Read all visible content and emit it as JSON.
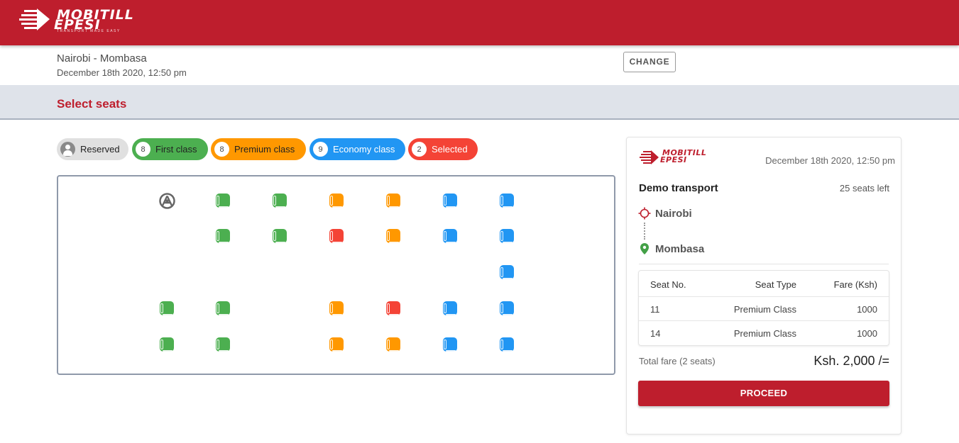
{
  "header": {
    "logo_line1": "MOBITILL",
    "logo_line2": "EPESI",
    "logo_tagline": "TRANSPORT MADE EASY",
    "background": "#be1e2d"
  },
  "trip": {
    "route": "Nairobi - Mombasa",
    "date": "December 18th 2020, 12:50 pm",
    "change_label": "CHANGE"
  },
  "section_title": "Select seats",
  "legend": [
    {
      "key": "reserved",
      "label": "Reserved",
      "count": null,
      "color": "#e0e0e0",
      "text_color": "#222"
    },
    {
      "key": "first",
      "label": "First class",
      "count": "8",
      "color": "#4caf50",
      "text_color": "#222"
    },
    {
      "key": "premium",
      "label": "Premium class",
      "count": "8",
      "color": "#ff9800",
      "text_color": "#222"
    },
    {
      "key": "economy",
      "label": "Economy class",
      "count": "9",
      "color": "#2196f3",
      "text_color": "#ffffff"
    },
    {
      "key": "selected",
      "label": "Selected",
      "count": "2",
      "color": "#f44336",
      "text_color": "#ffffff"
    }
  ],
  "seat_colors": {
    "first": "#4caf50",
    "premium": "#ff9800",
    "economy": "#2196f3",
    "selected": "#f44336"
  },
  "seat_rows": [
    [
      "steering",
      "first",
      "first",
      "premium",
      "premium",
      "economy",
      "economy"
    ],
    [
      null,
      "first",
      "first",
      "selected",
      "premium",
      "economy",
      "economy"
    ],
    [
      null,
      null,
      null,
      null,
      null,
      null,
      "economy"
    ],
    [
      "first",
      "first",
      null,
      "premium",
      "selected",
      "economy",
      "economy"
    ],
    [
      "first",
      "first",
      null,
      "premium",
      "premium",
      "economy",
      "economy"
    ]
  ],
  "summary": {
    "logo_line1": "MOBITILL",
    "logo_line2": "EPESI",
    "date": "December 18th 2020, 12:50 pm",
    "operator": "Demo transport",
    "seats_left": "25 seats left",
    "origin": "Nairobi",
    "destination": "Mombasa",
    "table_headers": [
      "Seat No.",
      "Seat Type",
      "Fare (Ksh)"
    ],
    "rows": [
      {
        "seat": "11",
        "type": "Premium Class",
        "fare": "1000"
      },
      {
        "seat": "14",
        "type": "Premium Class",
        "fare": "1000"
      }
    ],
    "total_label": "Total fare (2 seats)",
    "total_value": "Ksh. 2,000 /=",
    "proceed_label": "PROCEED"
  }
}
